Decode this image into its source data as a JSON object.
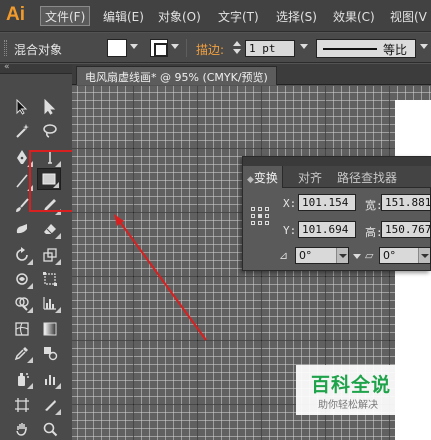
{
  "app": {
    "logo": "Ai"
  },
  "menu": {
    "items": [
      "文件(F)",
      "编辑(E)",
      "对象(O)",
      "文字(T)",
      "选择(S)",
      "效果(C)",
      "视图(V"
    ],
    "active_index": 0
  },
  "control_bar": {
    "selection_label": "混合对象",
    "stroke_label": "描边:",
    "stroke_weight": "1 pt",
    "profile_label": "等比"
  },
  "document": {
    "tab_title": "电风扇虚线画* @ 95% (CMYK/预览)"
  },
  "transform_panel": {
    "tabs": [
      "变换",
      "对齐",
      "路径查找器"
    ],
    "active_tab": 0,
    "x_label": "X:",
    "x_value": "101.154",
    "y_label": "Y:",
    "y_value": "101.694",
    "w_label": "宽:",
    "w_value": "151.881",
    "h_label": "高:",
    "h_value": "150.767",
    "rotate_value": "0°",
    "shear_value": "0°"
  },
  "toolbox": {
    "selected_tool": "rectangle-tool",
    "highlight_color": "#d82020"
  },
  "annotation": {
    "arrow_color": "#d82020"
  },
  "watermark": {
    "title": "百科全说",
    "subtitle": "助你轻松解决",
    "color": "#1fa34a"
  },
  "colors": {
    "ui_dark": "#424242",
    "panel": "#5a5a5a",
    "canvas": "#606060",
    "logo_orange": "#f29a2a"
  }
}
